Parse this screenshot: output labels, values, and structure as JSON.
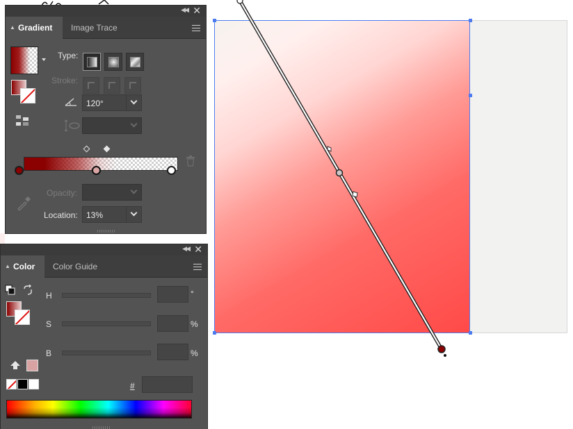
{
  "gradient_panel": {
    "tabs": [
      {
        "label": "Gradient",
        "active": true
      },
      {
        "label": "Image Trace",
        "active": false
      }
    ],
    "type_label": "Type:",
    "type_buttons": [
      "linear-gradient-icon",
      "radial-gradient-icon",
      "freeform-gradient-icon"
    ],
    "stroke_label": "Stroke:",
    "angle": {
      "icon": "angle-icon",
      "value": "120°"
    },
    "aspect_ratio": {
      "icon": "aspect-ratio-icon",
      "value": ""
    },
    "gradient_stops": [
      {
        "location_pct": 0,
        "color": "#8b0000"
      },
      {
        "location_pct": 50,
        "color": "#d9a5a5"
      },
      {
        "location_pct": 100,
        "color": "#ffffff"
      }
    ],
    "midpoints_pct": [
      44,
      57
    ],
    "opacity_label": "Opacity:",
    "opacity_value": "",
    "location_label": "Location:",
    "location_value": "13%"
  },
  "color_panel": {
    "tabs": [
      {
        "label": "Color",
        "active": true
      },
      {
        "label": "Color Guide",
        "active": false
      }
    ],
    "channels": [
      {
        "label": "H",
        "unit": "°",
        "value": ""
      },
      {
        "label": "S",
        "unit": "%",
        "value": ""
      },
      {
        "label": "B",
        "unit": "%",
        "value": ""
      }
    ],
    "hex_symbol": "#",
    "hex_value": "",
    "out_of_gamut_swatch": "#d9a3a3"
  },
  "colors": {
    "selection": "#4c7cf0",
    "panel_bg": "#535353",
    "gradient_start": "#f6f3ef",
    "gradient_end": "#ff4a48",
    "stop_dark_red": "#8b0000"
  }
}
